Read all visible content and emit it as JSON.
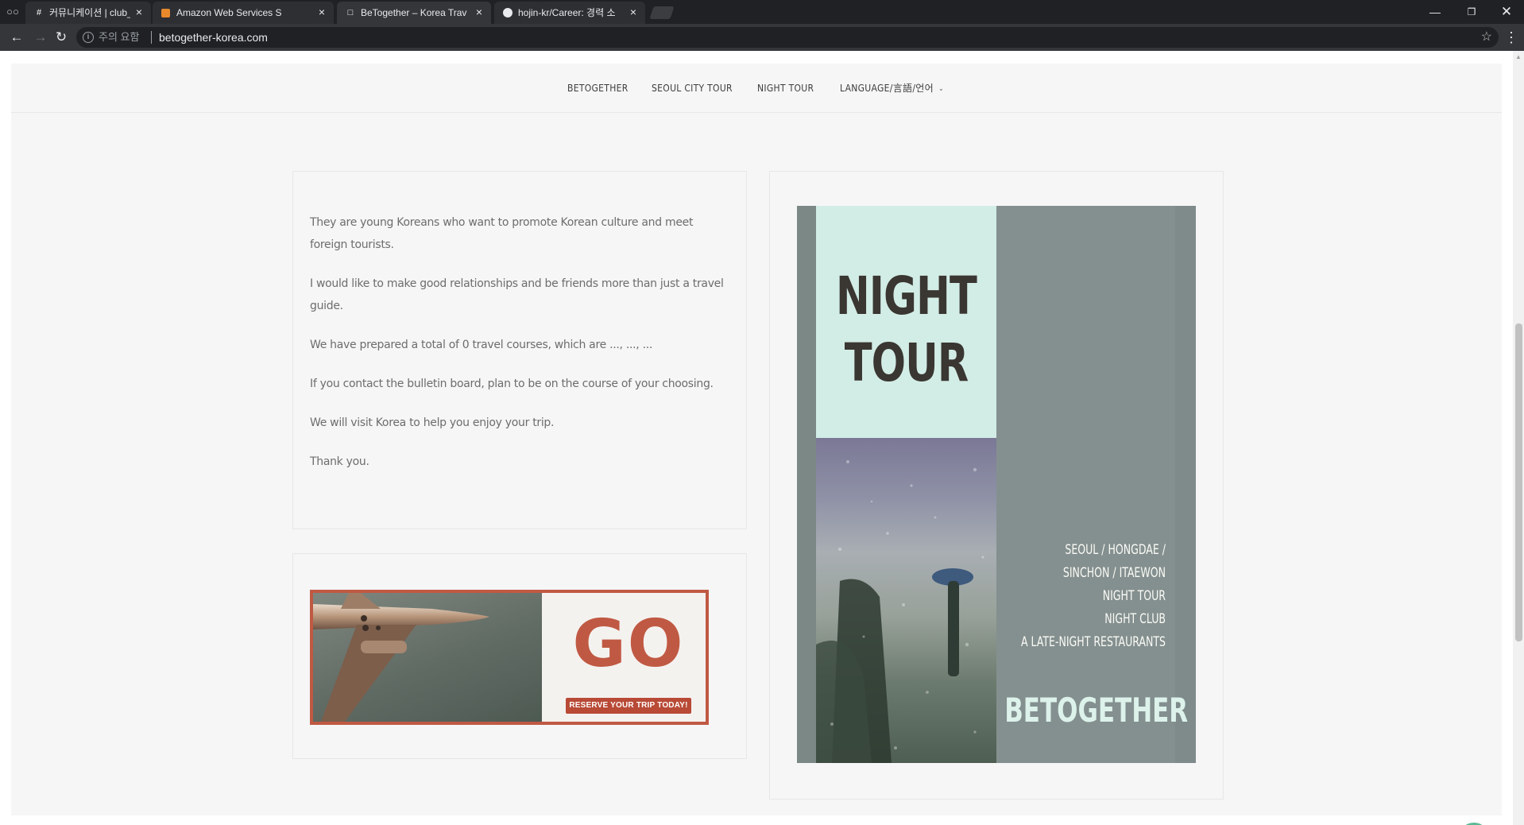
{
  "browser": {
    "tabs": [
      {
        "title": "커뮤니케이션 | club_univ",
        "icon": "#",
        "active": false
      },
      {
        "title": "Amazon Web Services S",
        "icon": "aws-cube",
        "active": false
      },
      {
        "title": "BeTogether – Korea Trav",
        "icon": "page",
        "active": true
      },
      {
        "title": "hojin-kr/Career: 경력 소",
        "icon": "github",
        "active": false
      }
    ],
    "security_label": "주의 요함",
    "url": "betogether-korea.com"
  },
  "nav": {
    "items": [
      "BETOGETHER",
      "SEOUL CITY TOUR",
      "NIGHT TOUR"
    ],
    "language_label": "LANGUAGE/言語/언어"
  },
  "content": {
    "paragraphs": [
      "They are young Koreans who want to promote Korean culture and meet foreign tourists.",
      "I would like to make good relationships and be friends more than just a travel guide.",
      "We have prepared a total of 0 travel courses, which are ..., ..., ...",
      "If you contact the bulletin board, plan to be on the course of your choosing.",
      "We will visit Korea to help you enjoy your trip.",
      "Thank you."
    ]
  },
  "ad": {
    "headline": "GO",
    "cta": "RESERVE YOUR TRIP TODAY!",
    "color": "#c05943"
  },
  "poster": {
    "title_line1": "NIGHT",
    "title_line2": "TOUR",
    "lines": [
      "SEOUL / HONGDAE /",
      "SINCHON / ITAEWON",
      "NIGHT TOUR",
      "NIGHT CLUB",
      "A LATE-NIGHT RESTAURANTS"
    ],
    "brand": "BETOGETHER",
    "accent": "#d2ede6"
  },
  "colors": {
    "to_top_button": "#5bba93",
    "page_background": "#f6f6f6"
  }
}
